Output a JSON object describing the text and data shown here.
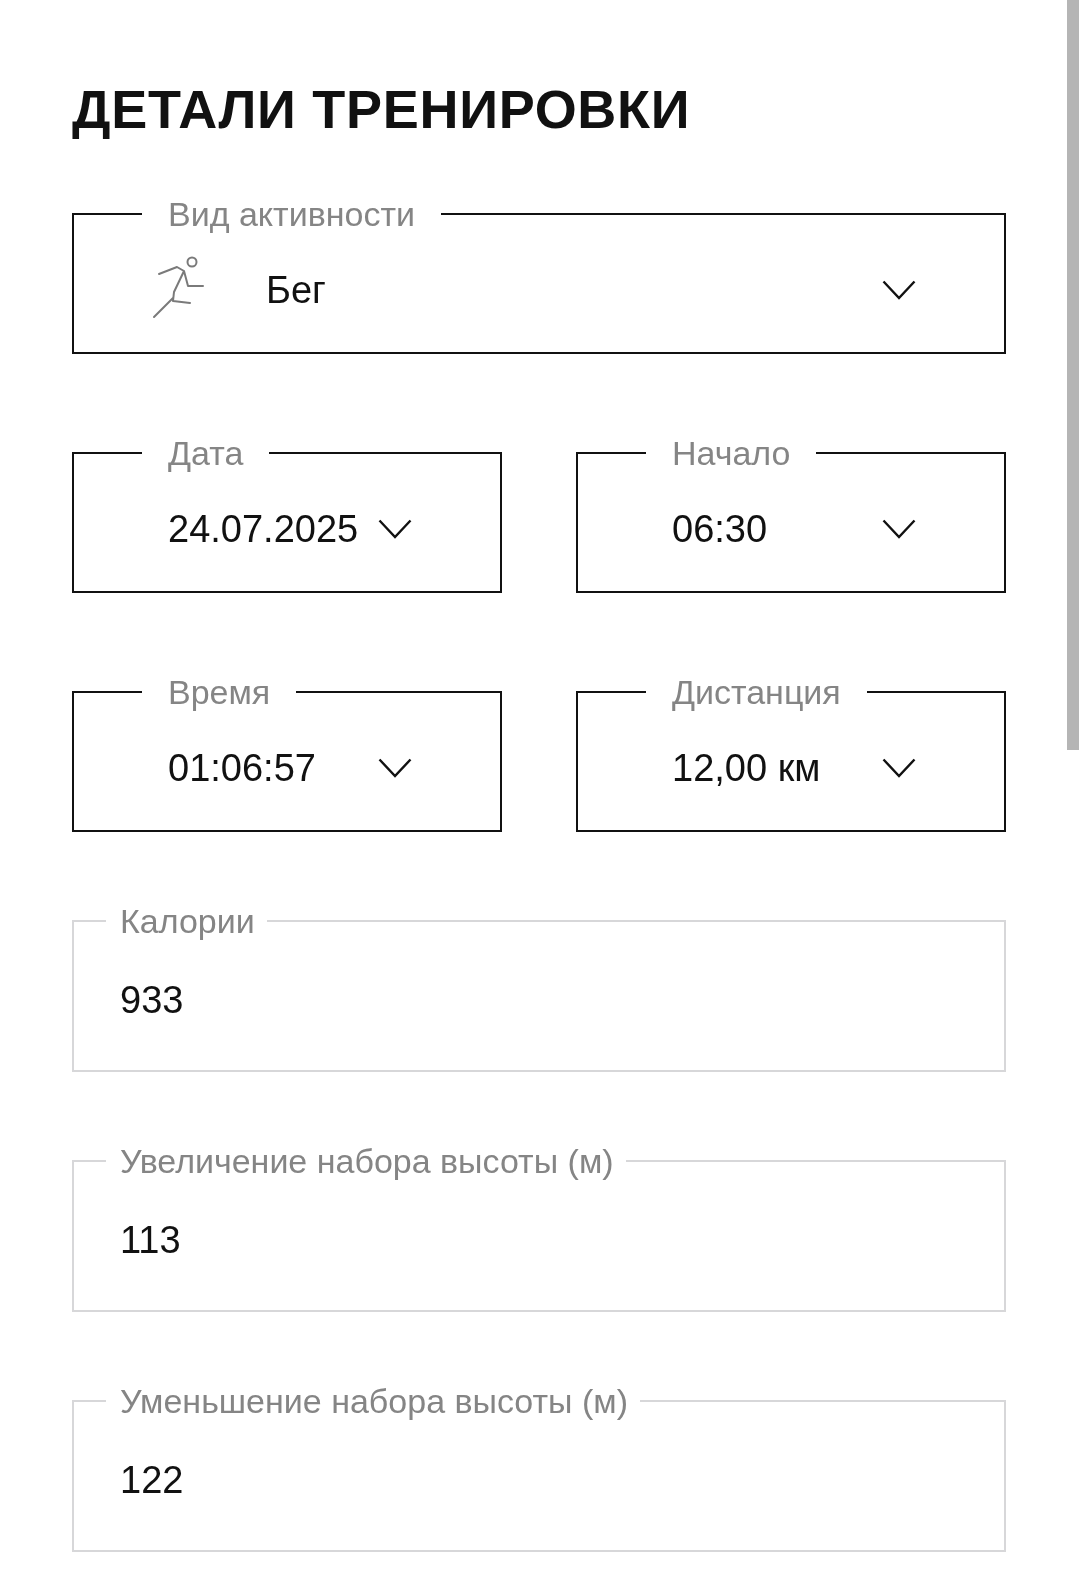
{
  "title": "ДЕТАЛИ ТРЕНИРОВКИ",
  "rows": [
    {
      "fields": [
        {
          "kind": "activity",
          "label": "Вид активности",
          "value": "Бег"
        }
      ]
    },
    {
      "fields": [
        {
          "kind": "select",
          "label": "Дата",
          "value": "24.07.2025"
        },
        {
          "kind": "select",
          "label": "Начало",
          "value": "06:30"
        }
      ]
    },
    {
      "fields": [
        {
          "kind": "select",
          "label": "Время",
          "value": "01:06:57"
        },
        {
          "kind": "select",
          "label": "Дистанция",
          "value": "12,00 км"
        }
      ]
    },
    {
      "fields": [
        {
          "kind": "input",
          "label": "Калории",
          "value": "933"
        }
      ]
    },
    {
      "fields": [
        {
          "kind": "input",
          "label": "Увеличение набора высоты (м)",
          "value": "113"
        }
      ]
    },
    {
      "fields": [
        {
          "kind": "input",
          "label": "Уменьшение набора высоты (м)",
          "value": "122"
        }
      ]
    }
  ]
}
